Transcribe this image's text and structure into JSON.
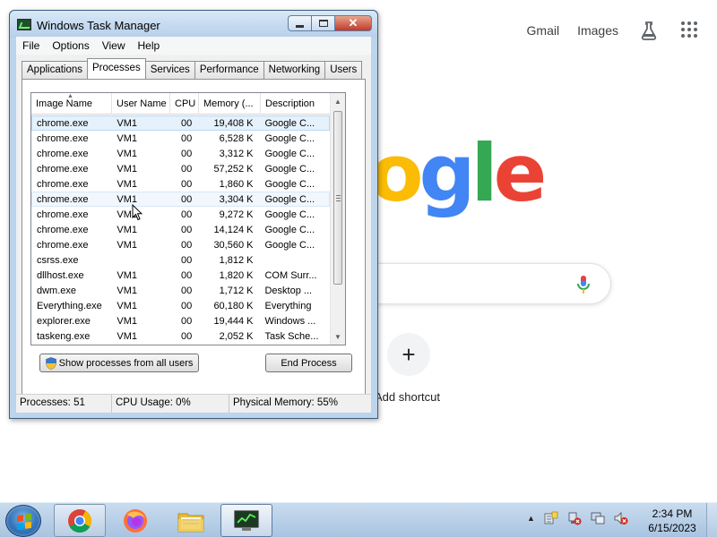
{
  "google": {
    "links": [
      "Gmail",
      "Images"
    ],
    "logo_letters": [
      {
        "char": "o",
        "color": "#fbbc05"
      },
      {
        "char": "g",
        "color": "#4285f4"
      },
      {
        "char": "l",
        "color": "#34a853"
      },
      {
        "char": "e",
        "color": "#ea4335"
      }
    ],
    "shortcut_icon": "+",
    "shortcut_label": "Add shortcut",
    "icons": {
      "labs": "flask-icon",
      "apps": "apps-grid-icon",
      "mic": "microphone-icon"
    }
  },
  "taskmgr": {
    "title": "Windows Task Manager",
    "menu": [
      "File",
      "Options",
      "View",
      "Help"
    ],
    "tabs": [
      "Applications",
      "Processes",
      "Services",
      "Performance",
      "Networking",
      "Users"
    ],
    "active_tab": "Processes",
    "columns": [
      "Image Name",
      "User Name",
      "CPU",
      "Memory (...",
      "Description"
    ],
    "rows": [
      {
        "name": "chrome.exe",
        "user": "VM1",
        "cpu": "00",
        "mem": "19,408 K",
        "desc": "Google C...",
        "state": "selected"
      },
      {
        "name": "chrome.exe",
        "user": "VM1",
        "cpu": "00",
        "mem": "6,528 K",
        "desc": "Google C...",
        "state": ""
      },
      {
        "name": "chrome.exe",
        "user": "VM1",
        "cpu": "00",
        "mem": "3,312 K",
        "desc": "Google C...",
        "state": ""
      },
      {
        "name": "chrome.exe",
        "user": "VM1",
        "cpu": "00",
        "mem": "57,252 K",
        "desc": "Google C...",
        "state": ""
      },
      {
        "name": "chrome.exe",
        "user": "VM1",
        "cpu": "00",
        "mem": "1,860 K",
        "desc": "Google C...",
        "state": ""
      },
      {
        "name": "chrome.exe",
        "user": "VM1",
        "cpu": "00",
        "mem": "3,304 K",
        "desc": "Google C...",
        "state": "hover"
      },
      {
        "name": "chrome.exe",
        "user": "VM1",
        "cpu": "00",
        "mem": "9,272 K",
        "desc": "Google C...",
        "state": ""
      },
      {
        "name": "chrome.exe",
        "user": "VM1",
        "cpu": "00",
        "mem": "14,124 K",
        "desc": "Google C...",
        "state": ""
      },
      {
        "name": "chrome.exe",
        "user": "VM1",
        "cpu": "00",
        "mem": "30,560 K",
        "desc": "Google C...",
        "state": ""
      },
      {
        "name": "csrss.exe",
        "user": "",
        "cpu": "00",
        "mem": "1,812 K",
        "desc": "",
        "state": ""
      },
      {
        "name": "dllhost.exe",
        "user": "VM1",
        "cpu": "00",
        "mem": "1,820 K",
        "desc": "COM Surr...",
        "state": ""
      },
      {
        "name": "dwm.exe",
        "user": "VM1",
        "cpu": "00",
        "mem": "1,712 K",
        "desc": "Desktop ...",
        "state": ""
      },
      {
        "name": "Everything.exe",
        "user": "VM1",
        "cpu": "00",
        "mem": "60,180 K",
        "desc": "Everything",
        "state": ""
      },
      {
        "name": "explorer.exe",
        "user": "VM1",
        "cpu": "00",
        "mem": "19,444 K",
        "desc": "Windows ...",
        "state": ""
      },
      {
        "name": "taskeng.exe",
        "user": "VM1",
        "cpu": "00",
        "mem": "2,052 K",
        "desc": "Task Sche...",
        "state": ""
      }
    ],
    "show_all_label": "Show processes from all users",
    "end_process_label": "End Process",
    "status": {
      "processes": "Processes: 51",
      "cpu": "CPU Usage: 0%",
      "memory": "Physical Memory: 55%"
    }
  },
  "taskbar": {
    "items": [
      {
        "name": "chrome-taskbar-button",
        "icon": "chrome-icon"
      },
      {
        "name": "firefox-taskbar-button",
        "icon": "firefox-icon"
      },
      {
        "name": "explorer-taskbar-button",
        "icon": "folder-icon"
      },
      {
        "name": "taskmgr-taskbar-button",
        "icon": "task-manager-icon"
      }
    ],
    "clock_time": "2:34 PM",
    "clock_date": "6/15/2023"
  }
}
